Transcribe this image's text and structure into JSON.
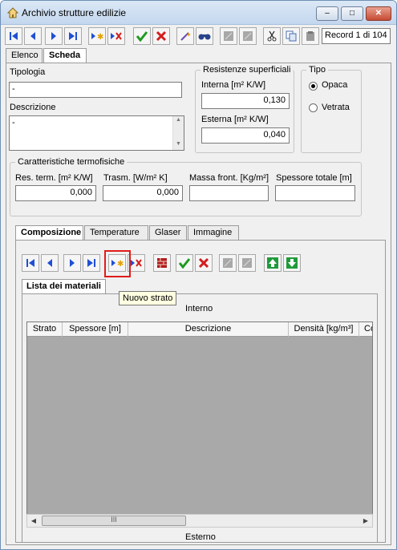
{
  "window": {
    "title": "Archivio strutture edilizie",
    "close_glyph": "✕",
    "min_glyph": "–",
    "max_glyph": "□"
  },
  "toolbar": {
    "record_indicator": "Record 1 di 104",
    "icons": [
      "first-icon",
      "prev-icon",
      "next-icon",
      "last-icon",
      "new-icon",
      "delete-icon",
      "confirm-icon",
      "cancel-icon",
      "wand-icon",
      "find-icon",
      "copy-disabled-icon",
      "paste-disabled-icon",
      "scissors-icon",
      "copy-icon",
      "paste-icon"
    ]
  },
  "tabs": [
    {
      "label": "Elenco"
    },
    {
      "label": "Scheda"
    }
  ],
  "scheda": {
    "tipologia_label": "Tipologia",
    "tipologia_value": "-",
    "descrizione_label": "Descrizione",
    "descrizione_value": "-",
    "resistenze": {
      "legend": "Resistenze superficiali",
      "interna_label": "Interna [m² K/W]",
      "interna_value": "0,130",
      "esterna_label": "Esterna  [m² K/W]",
      "esterna_value": "0,040"
    },
    "tipo": {
      "legend": "Tipo",
      "options": [
        {
          "label": "Opaca",
          "selected": true
        },
        {
          "label": "Vetrata",
          "selected": false
        }
      ]
    },
    "termofisiche": {
      "legend": "Caratteristiche termofisiche",
      "res_label": "Res. term. [m² K/W]",
      "res_value": "0,000",
      "trasm_label": "Trasm. [W/m² K]",
      "trasm_value": "0,000",
      "massa_label": "Massa front. [Kg/m²]",
      "massa_value": "",
      "spessore_label": "Spessore totale [m]",
      "spessore_value": ""
    }
  },
  "subtabs": [
    {
      "label": "Composizione"
    },
    {
      "label": "Temperature"
    },
    {
      "label": "Glaser"
    },
    {
      "label": "Immagine"
    }
  ],
  "composizione": {
    "tooltip": "Nuovo strato",
    "list_tab": "Lista dei materiali",
    "interno_label": "Interno",
    "esterno_label": "Esterno",
    "columns": [
      "Strato",
      "Spessore [m]",
      "Descrizione",
      "Densità [kg/m³]",
      "Co"
    ],
    "scroll_glyph": "III"
  }
}
